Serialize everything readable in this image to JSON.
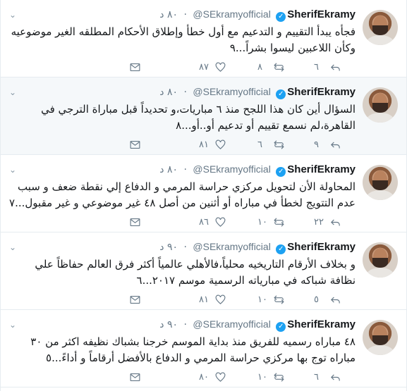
{
  "icons": {
    "menu": "chevron-down-icon",
    "reply": "reply-icon",
    "retweet": "retweet-icon",
    "like": "heart-icon",
    "dm": "mail-icon",
    "verified": "verified-badge-icon"
  },
  "colors": {
    "accent": "#1da1f2",
    "muted": "#657786",
    "highlight_bg": "#f5f8fa"
  },
  "tweets": [
    {
      "name": "SherifEkramy",
      "handle": "@SEkramyofficial",
      "time": "٨٠ د",
      "text": "فجأه يبدأ التقييم و التدعيم مع أول خطأ وإطلاق الأحكام المطلقه الغير موضوعيه وكأن اللاعبين ليسوا بشراً...٩",
      "reply": "٦",
      "retweet": "٨",
      "like": "٨٧",
      "highlight": false
    },
    {
      "name": "SherifEkramy",
      "handle": "@SEkramyofficial",
      "time": "٨٠ د",
      "text": "السؤال أين كان هذا اللجح منذ ٦ مباريات،و تحديداً قبل مباراة الترجي في القاهرة،لم نسمع تقييم أو تدعيم أو..أو...٨",
      "reply": "٩",
      "retweet": "٦",
      "like": "٨١",
      "highlight": true
    },
    {
      "name": "SherifEkramy",
      "handle": "@SEkramyofficial",
      "time": "٨٠ د",
      "text": "المحاولة الأن لتحويل مركزي حراسة المرمي و الدفاع إلي نقطة ضعف و سبب عدم التتويج لخطأ في مباراه أو أثنين من أصل ٤٨ غير موضوعي و غير مقبول...٧",
      "reply": "٢٢",
      "retweet": "١٠",
      "like": "٨٦",
      "highlight": false
    },
    {
      "name": "SherifEkramy",
      "handle": "@SEkramyofficial",
      "time": "٩٠ د",
      "text": "و بخلاف الأرقام التاريخيه محلياً،فالأهلي عالمياً أكثر فرق العالم حفاظاً علي نظافة شباكه في مبارياته الرسمية موسم ٢٠١٧...٦",
      "reply": "٥",
      "retweet": "١٠",
      "like": "٨١",
      "highlight": false
    },
    {
      "name": "SherifEkramy",
      "handle": "@SEkramyofficial",
      "time": "٩٠ د",
      "text": "٤٨ مباراه رسميه للفريق منذ بداية الموسم خرجنا بشباك نظيفه اكثر من ٣٠ مباراه توج بها مركزي حراسة المرمي و الدفاع بالأفضل أرقاماً و أداءً...٥",
      "reply": "٦",
      "retweet": "١٠",
      "like": "٨٠",
      "highlight": false
    }
  ]
}
